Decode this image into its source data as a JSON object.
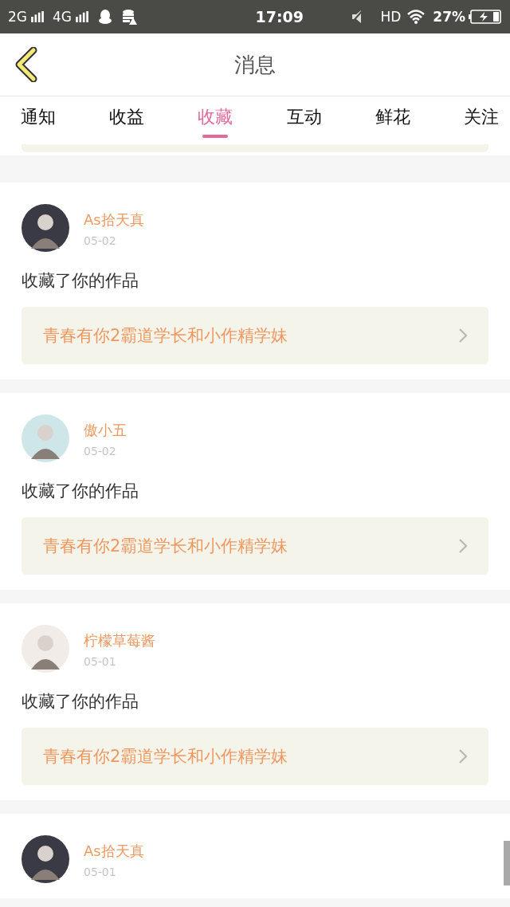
{
  "status_bar": {
    "network_1": "2G",
    "network_2": "4G",
    "time": "17:09",
    "hd": "HD",
    "battery": "27%"
  },
  "header": {
    "title": "消息"
  },
  "tabs": [
    {
      "label": "通知",
      "selected": false
    },
    {
      "label": "收益",
      "selected": false
    },
    {
      "label": "收藏",
      "selected": true
    },
    {
      "label": "互动",
      "selected": false
    },
    {
      "label": "鲜花",
      "selected": false
    },
    {
      "label": "关注",
      "selected": false
    }
  ],
  "messages": [
    {
      "user": "As拾天真",
      "date": "05-02",
      "action": "收藏了你的作品",
      "work": "青春有你2霸道学长和小作精学妹"
    },
    {
      "user": "傲小五",
      "date": "05-02",
      "action": "收藏了你的作品",
      "work": "青春有你2霸道学长和小作精学妹"
    },
    {
      "user": "柠檬草莓酱",
      "date": "05-01",
      "action": "收藏了你的作品",
      "work": "青春有你2霸道学长和小作精学妹"
    },
    {
      "user": "As拾天真",
      "date": "05-01"
    }
  ]
}
